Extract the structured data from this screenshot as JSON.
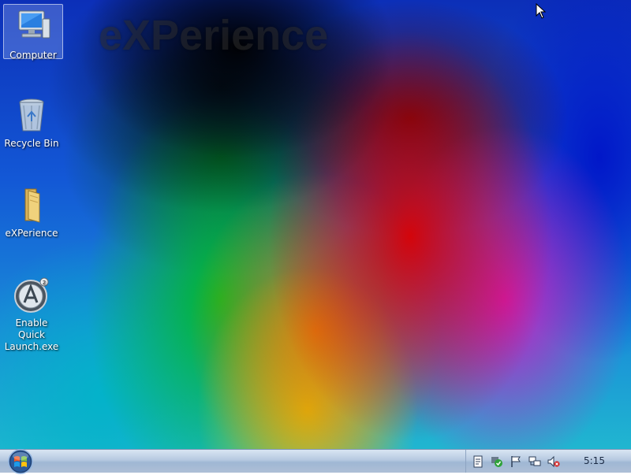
{
  "desktop": {
    "watermark": "eXPerience",
    "icons": [
      {
        "label": "Computer",
        "icon": "computer-icon",
        "selected": true
      },
      {
        "label": "Recycle Bin",
        "icon": "recycle-bin-icon"
      },
      {
        "label": "eXPerience",
        "icon": "folder-icon"
      },
      {
        "label": "Enable Quick Launch.exe",
        "icon": "quick-launch-app-icon"
      }
    ]
  },
  "taskbar": {
    "start_button": "start-orb-icon",
    "tray_icons": [
      "document-icon",
      "security-shield-icon",
      "flag-icon",
      "network-icon",
      "volume-muted-icon"
    ],
    "clock": "5:15"
  }
}
